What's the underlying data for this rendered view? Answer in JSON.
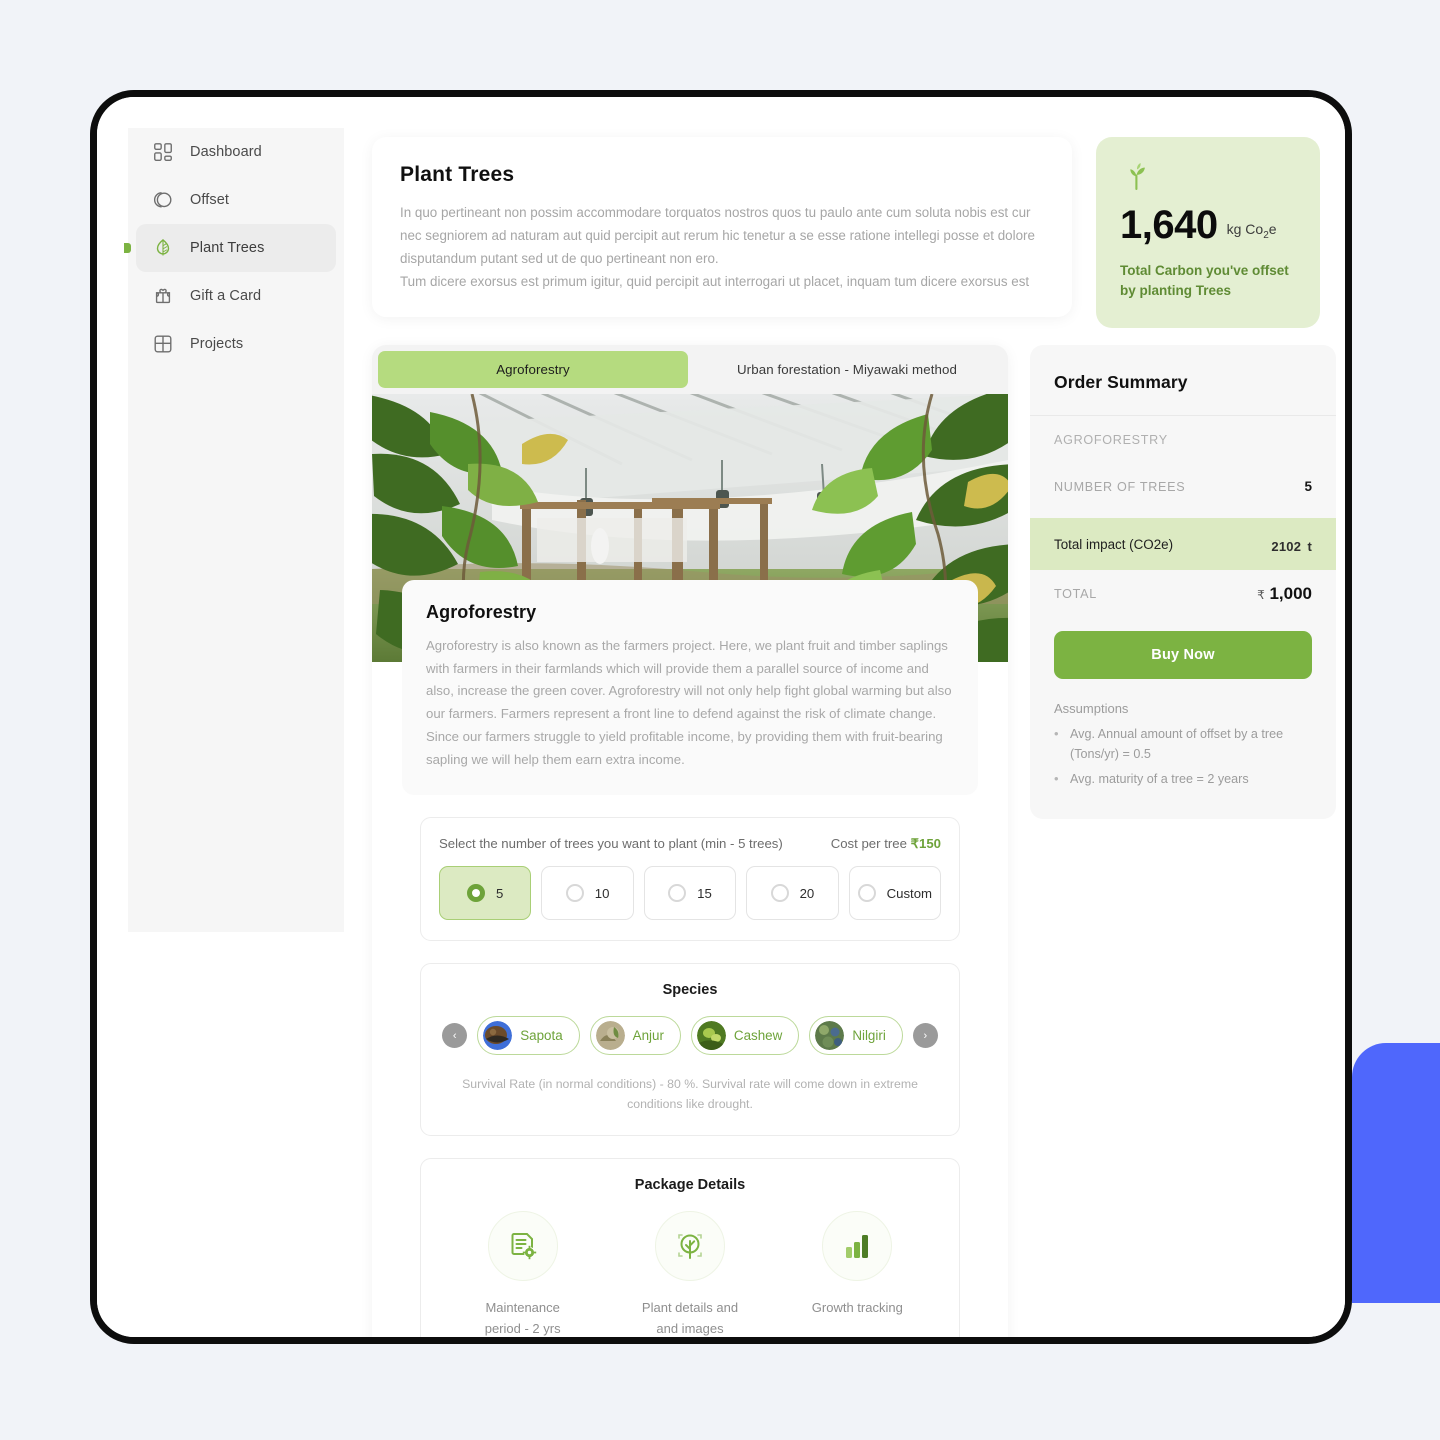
{
  "theme": {
    "accent_green": "#7cb342",
    "accent_green_light": "#dceac2",
    "stat_card_bg": "#e4efd2",
    "blue_shape": "#4f67fc",
    "page_bg": "#f1f3f8"
  },
  "sidebar": {
    "items": [
      {
        "label": "Dashboard",
        "icon": "dashboard-grid-icon",
        "active": false
      },
      {
        "label": "Offset",
        "icon": "offset-circles-icon",
        "active": false
      },
      {
        "label": "Plant Trees",
        "icon": "leaf-icon",
        "active": true
      },
      {
        "label": "Gift a Card",
        "icon": "gift-card-icon",
        "active": false
      },
      {
        "label": "Projects",
        "icon": "projects-window-icon",
        "active": false
      }
    ]
  },
  "intro": {
    "title": "Plant Trees",
    "paragraph_1": "In quo pertineant non possim accommodare torquatos nostros quos tu paulo ante cum soluta nobis est cur nec segniorem ad naturam aut quid percipit aut rerum hic tenetur a se esse ratione intellegi posse et dolore disputandum putant sed ut de quo pertineant non ero.",
    "paragraph_2": "Tum dicere exorsus est primum igitur, quid percipit aut interrogari ut placet, inquam tum dicere exorsus est"
  },
  "stat_card": {
    "icon": "sprout-icon",
    "value": "1,640",
    "unit_prefix": "kg Co",
    "unit_sub": "2",
    "unit_suffix": "e",
    "caption": "Total Carbon you've offset by planting Trees"
  },
  "tabs": [
    {
      "label": "Agroforestry",
      "active": true
    },
    {
      "label": "Urban forestation - Miyawaki method",
      "active": false
    }
  ],
  "hero": {
    "alt": "agroforestry-greenhouse-photo"
  },
  "description": {
    "title": "Agroforestry",
    "body": "Agroforestry is also known as the farmers project. Here, we plant fruit and timber saplings with farmers in their farmlands which will provide them a parallel source of income and also, increase the green cover. Agroforestry will not only help fight global warming but also our farmers. Farmers represent a front line to defend against the risk of climate change. Since our farmers struggle to yield profitable income, by providing them with fruit-bearing sapling we will help them earn extra income."
  },
  "tree_selector": {
    "prompt": "Select the number of trees you want to plant (min - 5 trees)",
    "cost_label": "Cost per tree ",
    "cost_value": "₹150",
    "options": [
      {
        "label": "5",
        "selected": true
      },
      {
        "label": "10",
        "selected": false
      },
      {
        "label": "15",
        "selected": false
      },
      {
        "label": "20",
        "selected": false
      },
      {
        "label": "Custom",
        "selected": false
      }
    ]
  },
  "species": {
    "title": "Species",
    "prev_arrow": "‹",
    "next_arrow": "›",
    "items": [
      {
        "label": "Sapota",
        "thumb": "sapota-thumb"
      },
      {
        "label": "Anjur",
        "thumb": "anjur-thumb"
      },
      {
        "label": "Cashew",
        "thumb": "cashew-thumb"
      },
      {
        "label": "Nilgiri",
        "thumb": "nilgiri-thumb"
      }
    ],
    "survival_note": "Survival Rate (in normal conditions) - 80 %. Survival rate will come down in extreme conditions like drought."
  },
  "package_details": {
    "title": "Package Details",
    "items": [
      {
        "icon": "document-gear-icon",
        "line1": "Maintenance",
        "line2": "period - 2 yrs"
      },
      {
        "icon": "tree-scan-icon",
        "line1": "Plant details and",
        "line2": "and images"
      },
      {
        "icon": "bar-chart-icon",
        "line1": "Growth tracking",
        "line2": ""
      }
    ]
  },
  "order_summary": {
    "title": "Order Summary",
    "category": "AGROFORESTRY",
    "trees_label": "NUMBER OF TREES",
    "trees_value": "5",
    "impact_label": "Total  impact (CO2e)",
    "impact_value": "2102",
    "impact_unit": "t",
    "total_label": "TOTAL",
    "total_currency": "₹",
    "total_value": "1,000",
    "buy_button": "Buy Now",
    "assumptions_title": "Assumptions",
    "assumptions": [
      "Avg. Annual amount of offset by a tree (Tons/yr) = 0.5",
      "Avg. maturity of a tree = 2 years"
    ]
  }
}
